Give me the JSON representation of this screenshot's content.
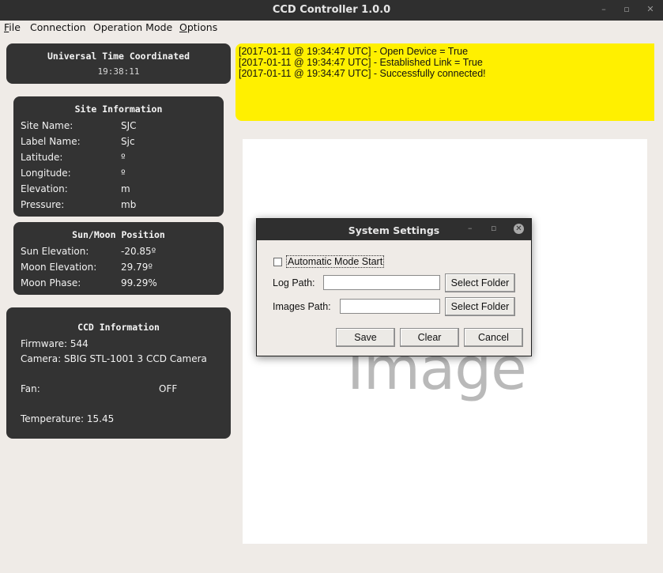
{
  "window": {
    "title": "CCD Controller 1.0.0"
  },
  "menu": [
    {
      "first": "F",
      "rest": "ile"
    },
    {
      "first": "",
      "rest": "Connection"
    },
    {
      "first": "",
      "rest": "Operation Mode"
    },
    {
      "first": "O",
      "rest": "ptions"
    }
  ],
  "utc": {
    "title": "Universal Time Coordinated",
    "time": "19:38:11"
  },
  "site": {
    "title": "Site Information",
    "rows": [
      {
        "label": "Site Name:",
        "value": "SJC"
      },
      {
        "label": "Label Name:",
        "value": "Sjc"
      },
      {
        "label": "Latitude:",
        "value": "º"
      },
      {
        "label": "Longitude:",
        "value": "º"
      },
      {
        "label": "Elevation:",
        "value": "m"
      },
      {
        "label": "Pressure:",
        "value": "mb"
      }
    ]
  },
  "sunmoon": {
    "title": "Sun/Moon Position",
    "rows": [
      {
        "label": "Sun Elevation:",
        "value": "-20.85º"
      },
      {
        "label": "Moon Elevation:",
        "value": "29.79º"
      },
      {
        "label": "Moon Phase:",
        "value": "99.29%"
      }
    ]
  },
  "ccd": {
    "title": "CCD Information",
    "firmware": "Firmware: 544",
    "camera": "Camera: SBIG STL-1001 3 CCD Camera",
    "fan_label": "Fan:",
    "fan_value": "OFF",
    "temperature": "Temperature:  15.45"
  },
  "log": [
    "[2017-01-11 @ 19:34:47 UTC] - Open Device = True",
    "[2017-01-11 @ 19:34:47 UTC] - Established Link = True",
    "[2017-01-11 @ 19:34:47 UTC] - Successfully connected!"
  ],
  "image_placeholder": "Image",
  "dialog": {
    "title": "System Settings",
    "auto_mode_label": "Automatic Mode Start",
    "auto_mode_checked": false,
    "log_path_label": "Log Path:",
    "log_path_value": "",
    "images_path_label": "Images Path:",
    "images_path_value": "",
    "select_folder_label": "Select Folder",
    "save_label": "Save",
    "clear_label": "Clear",
    "cancel_label": "Cancel"
  },
  "colors": {
    "panel": "#333333",
    "log_bg": "#fff000",
    "titlebar": "#2f2f2f"
  }
}
